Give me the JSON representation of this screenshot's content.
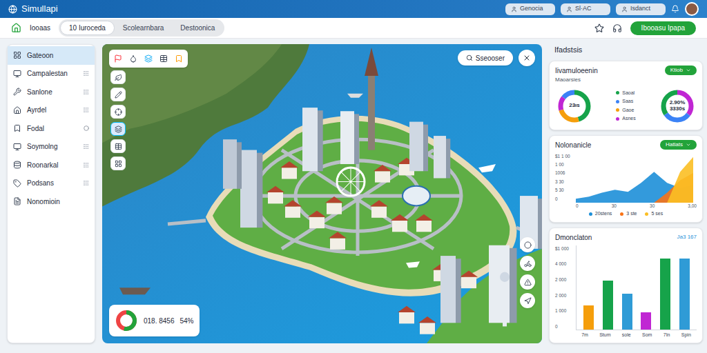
{
  "app": {
    "title": "Simullapi"
  },
  "header": {
    "pills": [
      {
        "label": "Genocia"
      },
      {
        "label": "Sl·AC"
      },
      {
        "label": "Isdanct"
      }
    ]
  },
  "toolbar": {
    "home_label": "Iooaas",
    "tabs": [
      {
        "label": "10 Iuroceda",
        "selected": true
      },
      {
        "label": "Scolearnbara",
        "selected": false
      },
      {
        "label": "Destoonica",
        "selected": false
      }
    ],
    "action_button": "Ibooasu Ipapa"
  },
  "sidebar": {
    "items": [
      {
        "label": "Gateoon",
        "selected": true,
        "kind": "none"
      },
      {
        "label": "Campalestan",
        "selected": false,
        "kind": "handle"
      },
      {
        "label": "Sanlone",
        "selected": false,
        "kind": "handle"
      },
      {
        "label": "Ayrdel",
        "selected": false,
        "kind": "handle"
      },
      {
        "label": "Fodal",
        "selected": false,
        "kind": "circle"
      },
      {
        "label": "Soymolng",
        "selected": false,
        "kind": "handle"
      },
      {
        "label": "Roonarkal",
        "selected": false,
        "kind": "handle"
      },
      {
        "label": "Podsans",
        "selected": false,
        "kind": "handle"
      },
      {
        "label": "Nonomioin",
        "selected": false,
        "kind": "none"
      }
    ]
  },
  "map": {
    "search_button": "Sseooser",
    "side_tools": [
      {
        "selected": false
      },
      {
        "selected": false
      },
      {
        "selected": false
      },
      {
        "selected": true
      },
      {
        "selected": false
      },
      {
        "selected": false
      }
    ],
    "gauge": {
      "value": "018. 8456",
      "percent": "54%",
      "level": 0.54
    }
  },
  "stats": {
    "title": "Ifadstsis",
    "donut_card": {
      "title": "Iivamuloeenin",
      "subtitle": "Maoarsies",
      "badge": "Ktiob",
      "donuts": [
        {
          "lines": [
            "23ıs"
          ],
          "segments": [
            {
              "value": 45,
              "color": "#16a34a"
            },
            {
              "value": 25,
              "color": "#f59e0b"
            },
            {
              "value": 15,
              "color": "#c026d3"
            },
            {
              "value": 15,
              "color": "#3b82f6"
            }
          ]
        },
        {
          "lines": [
            "2.90%",
            "3330s"
          ],
          "segments": [
            {
              "value": 35,
              "color": "#c026d3"
            },
            {
              "value": 30,
              "color": "#3b82f6"
            },
            {
              "value": 35,
              "color": "#16a34a"
            }
          ]
        }
      ],
      "legend": [
        {
          "label": "Saoal",
          "color": "#16a34a"
        },
        {
          "label": "Saas",
          "color": "#3b82f6"
        },
        {
          "label": "Gaoe",
          "color": "#f59e0b"
        },
        {
          "label": "Asnes",
          "color": "#c026d3"
        }
      ]
    },
    "area_card": {
      "title": "Nolonanicle",
      "badge": "Hatlats",
      "y_ticks": [
        "$1 1 00",
        "1 00",
        "1006",
        "3 30",
        "5 30",
        "0"
      ],
      "x_ticks": [
        "0",
        "30",
        "30",
        "3,00"
      ],
      "series": [
        {
          "name": "20stens",
          "color": "#1d8fd8",
          "values": [
            8,
            12,
            20,
            26,
            22,
            40,
            62,
            40,
            30,
            35
          ]
        },
        {
          "name": "3 ste",
          "color": "#f97316",
          "values": [
            0,
            0,
            0,
            0,
            0,
            0,
            0,
            20,
            45,
            60
          ]
        },
        {
          "name": "5 ses",
          "color": "#fbbf24",
          "values": [
            0,
            0,
            0,
            0,
            0,
            0,
            0,
            0,
            62,
            92
          ]
        }
      ]
    },
    "bar_card": {
      "title": "Dmonclaton",
      "badge": "Ja3 167",
      "y_ticks": [
        "$1 000",
        "4 000",
        "2 000",
        "2 000",
        "1 000",
        "0"
      ],
      "bars": [
        {
          "label": "7m",
          "value": 28,
          "color": "#f59e0b"
        },
        {
          "label": "Stum",
          "value": 58,
          "color": "#16a34a"
        },
        {
          "label": "sole",
          "value": 42,
          "color": "#2f9bd6"
        },
        {
          "label": "Som",
          "value": 20,
          "color": "#c026d3"
        },
        {
          "label": "7In",
          "value": 84,
          "color": "#16a34a"
        },
        {
          "label": "Spin",
          "value": 84,
          "color": "#2f9bd6"
        }
      ]
    }
  }
}
